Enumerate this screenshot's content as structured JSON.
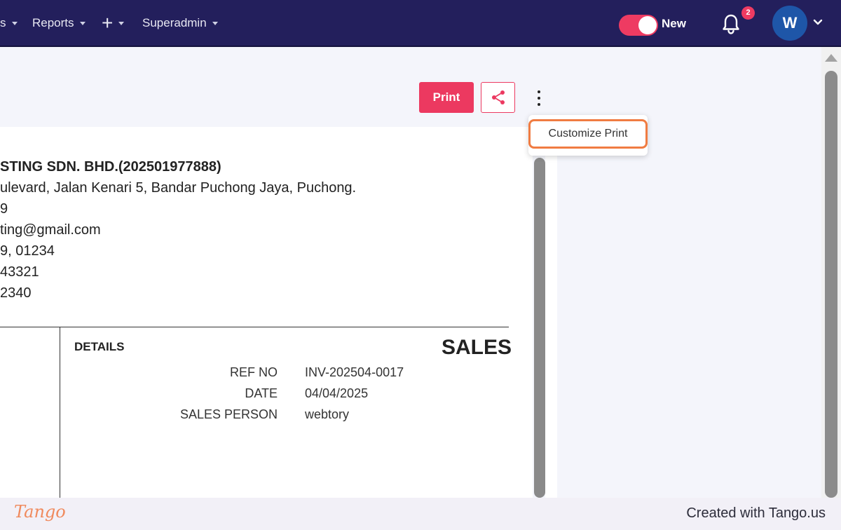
{
  "nav": {
    "items": [
      {
        "label": "s",
        "has_caret": true
      },
      {
        "label": "Reports",
        "has_caret": true
      },
      {
        "label": "+",
        "has_caret": true
      },
      {
        "label": "Superadmin",
        "has_caret": true
      }
    ],
    "new_toggle_label": "New",
    "new_toggle_on": true,
    "notification_count": "2",
    "avatar_initial": "W"
  },
  "toolbar": {
    "print_label": "Print",
    "share_icon": "share-icon",
    "more_icon": "kebab-icon"
  },
  "dropdown": {
    "items": [
      {
        "label": "Customize Print"
      }
    ]
  },
  "document": {
    "company_name": "STING SDN. BHD.(202501977888)",
    "address_lines": [
      "ulevard, Jalan Kenari 5, Bandar Puchong Jaya, Puchong.",
      "9",
      "ting@gmail.com",
      "9, 01234",
      "43321",
      "2340"
    ],
    "details_heading": "DETAILS",
    "doc_type": "SALES",
    "details": [
      {
        "label": "REF NO",
        "value": "INV-202504-0017"
      },
      {
        "label": "DATE",
        "value": "04/04/2025"
      },
      {
        "label": "SALES PERSON",
        "value": "webtory"
      }
    ]
  },
  "footer": {
    "logo_text": "Tango",
    "credit": "Created with Tango.us"
  },
  "colors": {
    "topbar": "#231f5c",
    "accent": "#ec3960",
    "highlight": "#f07c42",
    "avatar": "#1e56a8"
  }
}
